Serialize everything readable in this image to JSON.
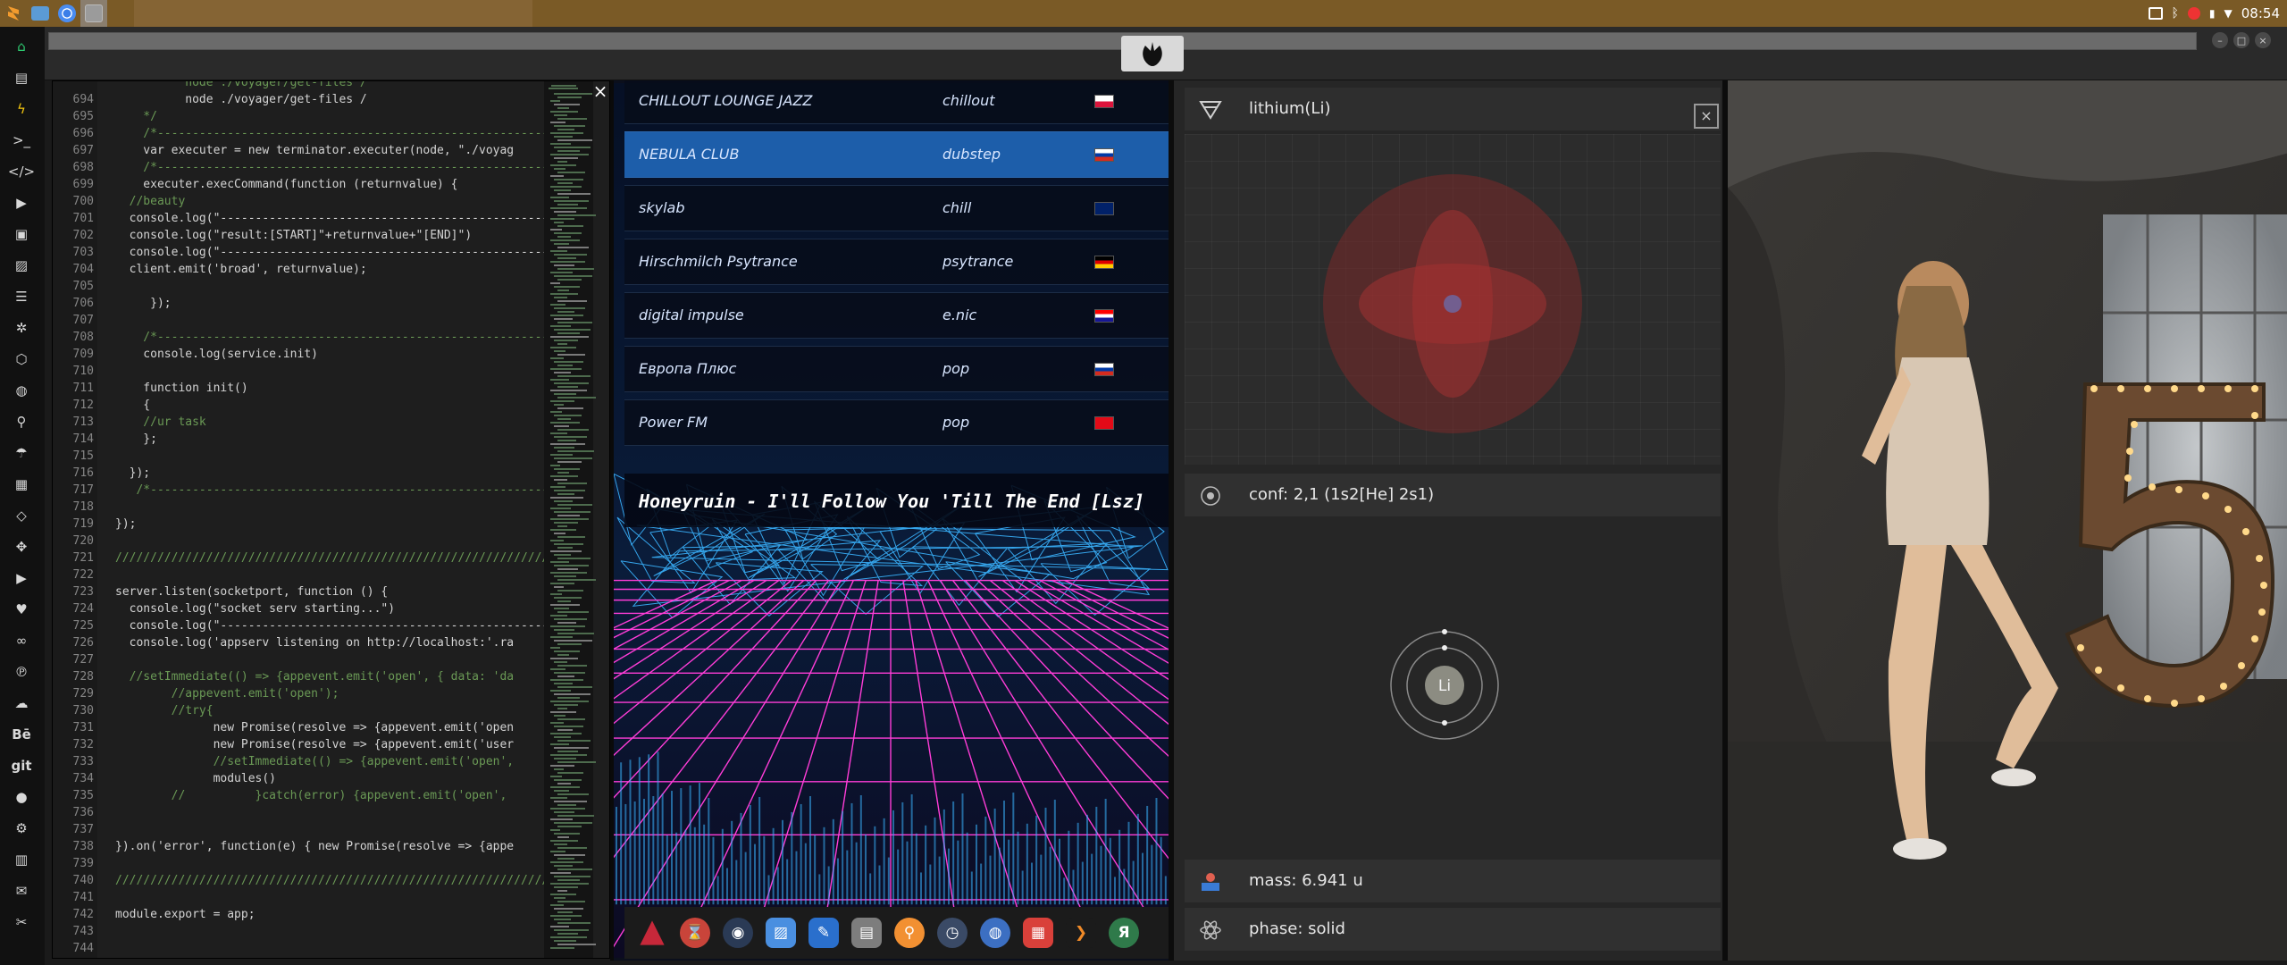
{
  "topbar": {
    "clock": "08:54",
    "apps": [
      "sublime-text-icon",
      "files-icon",
      "chromium-icon",
      "terminal-icon"
    ]
  },
  "dock": {
    "items": [
      "home-icon",
      "document-icon",
      "bolt-icon",
      "terminal-icon",
      "code-icon",
      "play-icon",
      "video-icon",
      "image-icon",
      "reader-icon",
      "nodes-icon",
      "steam-icon",
      "globe-icon",
      "search-icon",
      "umbrella-icon",
      "contacts-icon",
      "flow-icon",
      "expand-icon",
      "youtube-icon",
      "heart-icon",
      "lastfm-icon",
      "pinterest-icon",
      "cloud-icon",
      "behance-icon",
      "git-icon",
      "github-icon",
      "bitbucket-icon",
      "map-icon",
      "mail-icon",
      "tools-icon"
    ],
    "labels": {
      "behance": "Bē",
      "git": "git"
    }
  },
  "editor": {
    "close": "×",
    "lines": [
      {
        "n": "",
        "t": "          node ./voyager/get-files /"
      },
      {
        "n": "694",
        "t": "          node ./voyager/get-files /"
      },
      {
        "n": "695",
        "t": "    */"
      },
      {
        "n": "696",
        "t": "    /*------------------------------------------------------------"
      },
      {
        "n": "697",
        "t": "    var executer = new terminator.executer(node, \"./voyag"
      },
      {
        "n": "698",
        "t": "    /*------------------------------------------------------------"
      },
      {
        "n": "699",
        "t": "    executer.execCommand(function (returnvalue) {"
      },
      {
        "n": "700",
        "t": "  //beauty"
      },
      {
        "n": "701",
        "t": "  console.log(\"------------------------------------------------"
      },
      {
        "n": "702",
        "t": "  console.log(\"result:[START]\"+returnvalue+\"[END]\")"
      },
      {
        "n": "703",
        "t": "  console.log(\"------------------------------------------------"
      },
      {
        "n": "704",
        "t": "  client.emit('broad', returnvalue);"
      },
      {
        "n": "705",
        "t": ""
      },
      {
        "n": "706",
        "t": "     });"
      },
      {
        "n": "707",
        "t": ""
      },
      {
        "n": "708",
        "t": "    /*------------------------------------------------------------"
      },
      {
        "n": "709",
        "t": "    console.log(service.init)"
      },
      {
        "n": "710",
        "t": ""
      },
      {
        "n": "711",
        "t": "    function init()"
      },
      {
        "n": "712",
        "t": "    {"
      },
      {
        "n": "713",
        "t": "    //ur task"
      },
      {
        "n": "714",
        "t": "    };"
      },
      {
        "n": "715",
        "t": ""
      },
      {
        "n": "716",
        "t": "  });"
      },
      {
        "n": "717",
        "t": "   /*-------------------------------------------------------------"
      },
      {
        "n": "718",
        "t": ""
      },
      {
        "n": "719",
        "t": "});"
      },
      {
        "n": "720",
        "t": ""
      },
      {
        "n": "721",
        "t": "//////////////////////////////////////////////////////////////"
      },
      {
        "n": "722",
        "t": ""
      },
      {
        "n": "723",
        "t": "server.listen(socketport, function () {"
      },
      {
        "n": "724",
        "t": "  console.log(\"socket serv starting...\")"
      },
      {
        "n": "725",
        "t": "  console.log(\"------------------------------------------------"
      },
      {
        "n": "726",
        "t": "  console.log('appserv listening on http://localhost:'.ra"
      },
      {
        "n": "727",
        "t": ""
      },
      {
        "n": "728",
        "t": "  //setImmediate(() => {appevent.emit('open', { data: 'da"
      },
      {
        "n": "729",
        "t": "        //appevent.emit('open');"
      },
      {
        "n": "730",
        "t": "        //try{"
      },
      {
        "n": "731",
        "t": "              new Promise(resolve => {appevent.emit('open"
      },
      {
        "n": "732",
        "t": "              new Promise(resolve => {appevent.emit('user"
      },
      {
        "n": "733",
        "t": "              //setImmediate(() => {appevent.emit('open',"
      },
      {
        "n": "734",
        "t": "              modules()"
      },
      {
        "n": "735",
        "t": "        //          }catch(error) {appevent.emit('open',"
      },
      {
        "n": "736",
        "t": ""
      },
      {
        "n": "737",
        "t": ""
      },
      {
        "n": "738",
        "t": "}).on('error', function(e) { new Promise(resolve => {appe"
      },
      {
        "n": "739",
        "t": ""
      },
      {
        "n": "740",
        "t": "//////////////////////////////////////////////////////////////"
      },
      {
        "n": "741",
        "t": ""
      },
      {
        "n": "742",
        "t": "module.export = app;"
      },
      {
        "n": "743",
        "t": ""
      },
      {
        "n": "744",
        "t": ""
      }
    ]
  },
  "radio": {
    "stations": [
      {
        "name": "CHILLOUT LOUNGE JAZZ",
        "genre": "chillout",
        "flag": "poland"
      },
      {
        "name": "NEBULA CLUB",
        "genre": "dubstep",
        "flag": "russia",
        "active": true
      },
      {
        "name": "skylab",
        "genre": "chill",
        "flag": "uk"
      },
      {
        "name": "Hirschmilch Psytrance",
        "genre": "psytrance",
        "flag": "germany"
      },
      {
        "name": "digital impulse",
        "genre": "e.nic",
        "flag": "croatia"
      },
      {
        "name": "Европа Плюс",
        "genre": "pop",
        "flag": "russia"
      },
      {
        "name": "Power FM",
        "genre": "pop",
        "flag": "turkey"
      }
    ],
    "now_playing": "Honeyruin - I'll Follow You 'Till The End [Lsz]",
    "launcher": [
      "arch-icon",
      "hourglass-icon",
      "steam-icon",
      "image-viewer-icon",
      "image-editor-icon",
      "reader-icon",
      "search-icon",
      "clock-icon",
      "globe-icon",
      "calendar-icon",
      "terminal-icon",
      "yandex-icon"
    ],
    "colors": {
      "active": "#1d5eaa",
      "grid_pink": "#ff3dd8",
      "grid_blue": "#3ab4ff"
    }
  },
  "element": {
    "title": "lithium(Li)",
    "close": "×",
    "conf": "conf: 2,1 (1s2[He] 2s1)",
    "symbol": "Li",
    "mass": "mass: 6.941 u",
    "phase": "phase: solid",
    "icons": [
      "element-icon",
      "close-icon",
      "atom-config-icon",
      "mass-icon",
      "atom-icon"
    ]
  },
  "photo": {
    "description_icon": "photo-wallpaper"
  }
}
